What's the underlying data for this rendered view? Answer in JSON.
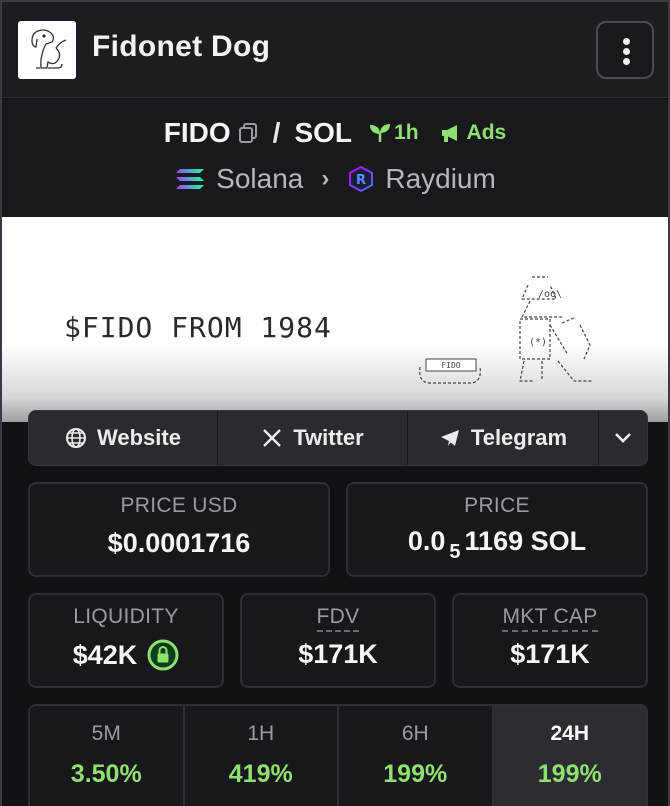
{
  "header": {
    "token_name": "Fidonet Dog",
    "menu_icon": "kebab-vertical-icon"
  },
  "pair": {
    "base": "FIDO",
    "separator": "/",
    "quote": "SOL",
    "age": "1h",
    "ads": "Ads",
    "chain": "Solana",
    "dex": "Raydium",
    "accent": "#8ee06f"
  },
  "banner": {
    "text": "$FIDO FROM 1984",
    "bowl_label": "FIDO"
  },
  "links": [
    {
      "label": "Website",
      "icon": "globe-icon"
    },
    {
      "label": "Twitter",
      "icon": "x-logo-icon"
    },
    {
      "label": "Telegram",
      "icon": "telegram-icon"
    }
  ],
  "stats": {
    "price_usd": {
      "label": "PRICE USD",
      "value": "$0.0001716"
    },
    "price_native": {
      "label": "PRICE",
      "prefix": "0.0",
      "sub": "5",
      "suffix": "1169 SOL"
    },
    "liquidity": {
      "label": "LIQUIDITY",
      "value": "$42K"
    },
    "fdv": {
      "label": "FDV",
      "value": "$171K"
    },
    "mkt_cap": {
      "label": "MKT CAP",
      "value": "$171K"
    }
  },
  "changes": [
    {
      "label": "5M",
      "value": "3.50%"
    },
    {
      "label": "1H",
      "value": "419%"
    },
    {
      "label": "6H",
      "value": "199%"
    },
    {
      "label": "24H",
      "value": "199%",
      "active": true
    }
  ]
}
